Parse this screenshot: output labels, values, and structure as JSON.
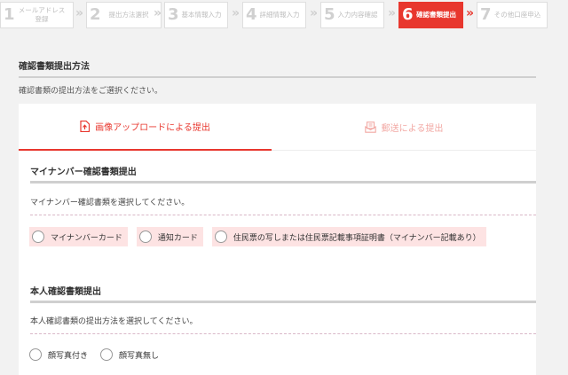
{
  "steps": [
    {
      "num": "1",
      "label": "メールアドレス\n登録"
    },
    {
      "num": "2",
      "label": "提出方法選択"
    },
    {
      "num": "3",
      "label": "基本情報入力"
    },
    {
      "num": "4",
      "label": "詳細情報入力"
    },
    {
      "num": "5",
      "label": "入力内容確認"
    },
    {
      "num": "6",
      "label": "確認書類提出"
    },
    {
      "num": "7",
      "label": "その他口座申込"
    }
  ],
  "step_separator": "»",
  "section": {
    "title": "確認書類提出方法",
    "description": "確認書類の提出方法をご選択ください。"
  },
  "tabs": [
    {
      "label": "画像アップロードによる提出",
      "icon": "upload-file-icon",
      "active": true
    },
    {
      "label": "郵送による提出",
      "icon": "mail-document-icon",
      "active": false
    }
  ],
  "mynumber": {
    "title": "マイナンバー確認書類提出",
    "description": "マイナンバー確認書類を選択してください。",
    "options": [
      "マイナンバーカード",
      "通知カード",
      "住民票の写しまたは住民票記載事項証明書（マイナンバー記載あり）"
    ]
  },
  "identity": {
    "title": "本人確認書類提出",
    "description": "本人確認書類の提出方法を選択してください。",
    "options": [
      "顔写真付き",
      "顔写真無し"
    ]
  },
  "colors": {
    "accent": "#e8372e",
    "accent_light": "#f2a9a4",
    "option_bg": "#fde3e3",
    "page_bg": "#f2f2f2"
  }
}
